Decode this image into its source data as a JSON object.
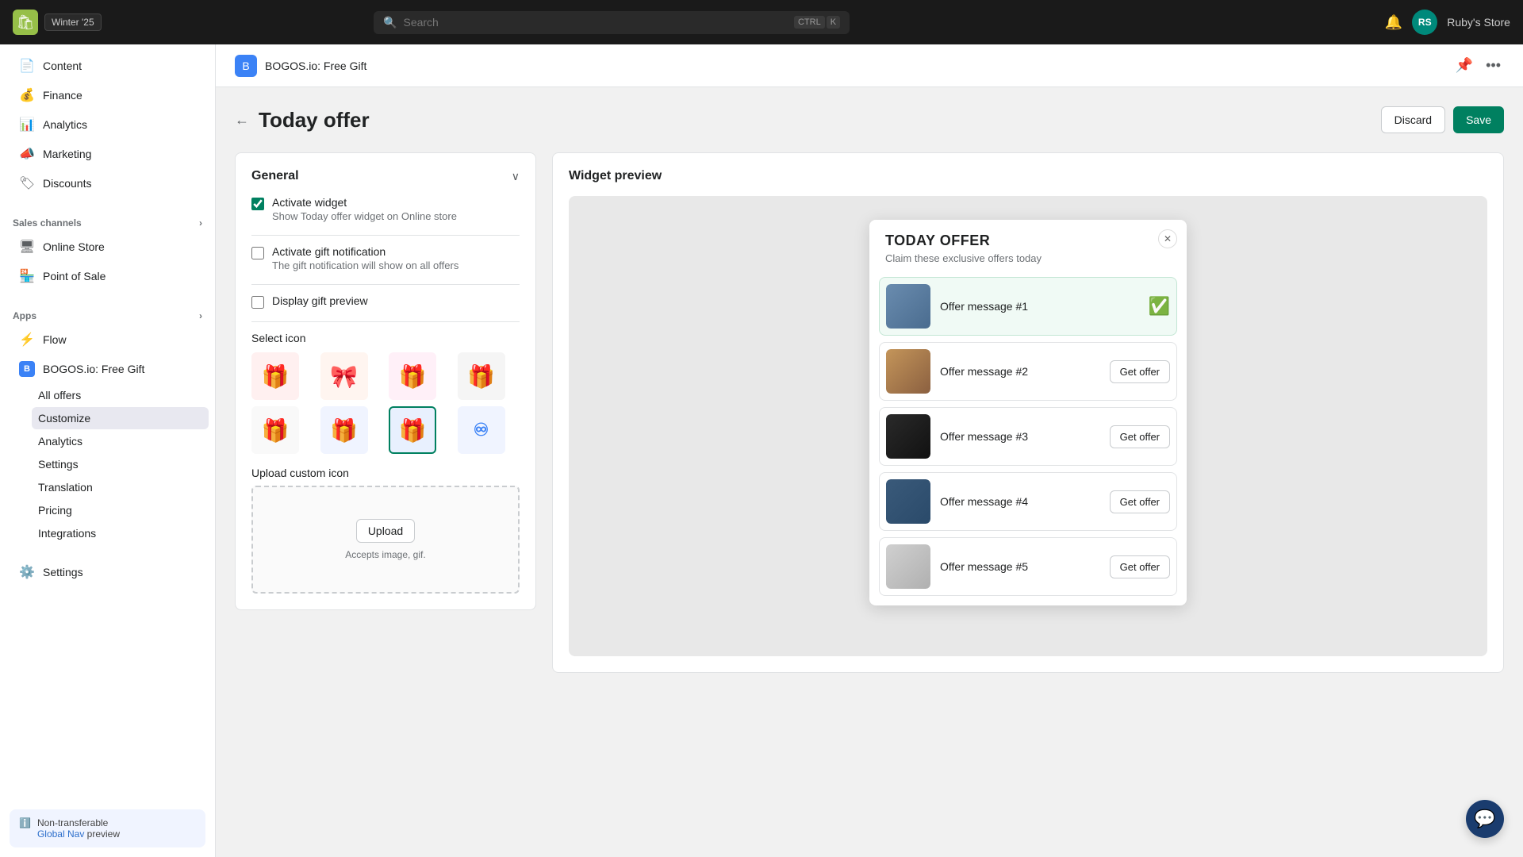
{
  "topbar": {
    "logo_emoji": "🛍",
    "badge_label": "Winter '25",
    "search_placeholder": "Search",
    "search_ctrl": "CTRL",
    "search_k": "K",
    "store_initials": "RS",
    "store_name": "Ruby's Store"
  },
  "sidebar": {
    "nav_items": [
      {
        "id": "content",
        "label": "Content",
        "icon": "📄"
      },
      {
        "id": "finance",
        "label": "Finance",
        "icon": "💰"
      },
      {
        "id": "analytics",
        "label": "Analytics",
        "icon": "📊"
      },
      {
        "id": "marketing",
        "label": "Marketing",
        "icon": "📣"
      },
      {
        "id": "discounts",
        "label": "Discounts",
        "icon": "🏷"
      }
    ],
    "sales_channels_label": "Sales channels",
    "sales_channels": [
      {
        "id": "online-store",
        "label": "Online Store",
        "icon": "🖥"
      },
      {
        "id": "point-of-sale",
        "label": "Point of Sale",
        "icon": "🏪"
      }
    ],
    "apps_label": "Apps",
    "apps": [
      {
        "id": "flow",
        "label": "Flow",
        "icon": "⚡"
      },
      {
        "id": "bogos",
        "label": "BOGOS.io: Free Gift",
        "icon": "🎁"
      }
    ],
    "bogos_sub_items": [
      {
        "id": "all-offers",
        "label": "All offers"
      },
      {
        "id": "customize",
        "label": "Customize",
        "active": true
      },
      {
        "id": "analytics",
        "label": "Analytics"
      },
      {
        "id": "settings",
        "label": "Settings"
      },
      {
        "id": "translation",
        "label": "Translation"
      },
      {
        "id": "pricing",
        "label": "Pricing"
      },
      {
        "id": "integrations",
        "label": "Integrations"
      }
    ],
    "settings_label": "Settings",
    "settings_icon": "⚙",
    "footer": {
      "info_icon": "ℹ",
      "title": "Non-transferable",
      "link_text": "Global Nav",
      "suffix_text": " preview"
    }
  },
  "app_header": {
    "icon": "B",
    "title": "BOGOS.io: Free Gift",
    "pin_icon": "📌",
    "more_icon": "•••"
  },
  "page": {
    "back_label": "←",
    "title": "Today offer",
    "discard_label": "Discard",
    "save_label": "Save"
  },
  "general_panel": {
    "title": "General",
    "chevron": "∨",
    "activate_widget_label": "Activate widget",
    "activate_widget_desc": "Show Today offer widget on Online store",
    "activate_widget_checked": true,
    "gift_notification_label": "Activate gift notification",
    "gift_notification_desc": "The gift notification will show on all offers",
    "gift_notification_checked": false,
    "display_preview_label": "Display gift preview",
    "display_preview_checked": false,
    "select_icon_label": "Select icon",
    "upload_icon_label": "Upload custom icon",
    "upload_btn_label": "Upload",
    "upload_hint": "Accepts image, gif."
  },
  "widget_preview": {
    "title": "Widget preview",
    "widget_title": "TODAY OFFER",
    "widget_subtitle": "Claim these exclusive offers today",
    "offers": [
      {
        "id": 1,
        "message": "Offer message #1",
        "claimed": true
      },
      {
        "id": 2,
        "message": "Offer message #2",
        "claimed": false,
        "btn": "Get offer"
      },
      {
        "id": 3,
        "message": "Offer message #3",
        "claimed": false,
        "btn": "Get offer"
      },
      {
        "id": 4,
        "message": "Offer message #4",
        "claimed": false,
        "btn": "Get offer"
      },
      {
        "id": 5,
        "message": "Offer message #5",
        "claimed": false,
        "btn": "Get offer"
      }
    ]
  },
  "icons": {
    "gift_icons": [
      "🎁",
      "🎀",
      "🎁",
      "🎁",
      "🎁",
      "🎁",
      "🎁",
      "♾"
    ],
    "selected_index": 6
  }
}
